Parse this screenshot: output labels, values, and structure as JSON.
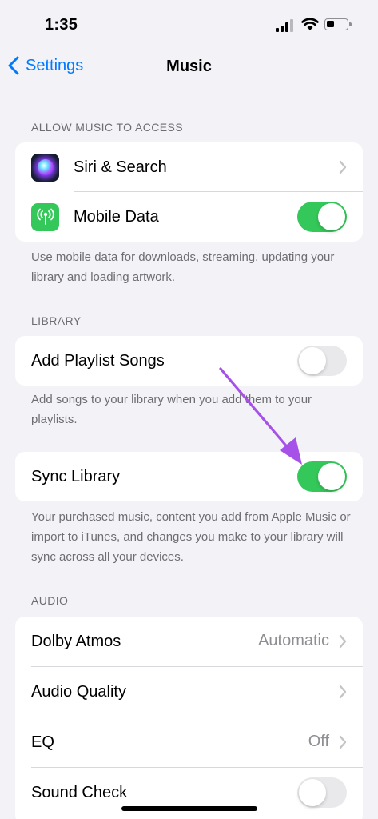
{
  "status_bar": {
    "time": "1:35"
  },
  "nav": {
    "back_label": "Settings",
    "title": "Music"
  },
  "sections": {
    "access": {
      "header": "ALLOW MUSIC TO ACCESS",
      "rows": [
        {
          "label": "Siri & Search",
          "icon": "siri-icon"
        },
        {
          "label": "Mobile Data",
          "icon": "antenna-icon",
          "toggle": true
        }
      ],
      "footer": "Use mobile data for downloads, streaming, updating your library and loading artwork."
    },
    "library": {
      "header": "LIBRARY",
      "add_playlist": {
        "label": "Add Playlist Songs",
        "toggle": false
      },
      "add_playlist_footer": "Add songs to your library when you add them to your playlists.",
      "sync": {
        "label": "Sync Library",
        "toggle": true
      },
      "sync_footer": "Your purchased music, content you add from Apple Music or import to iTunes, and changes you make to your library will sync across all your devices."
    },
    "audio": {
      "header": "AUDIO",
      "rows": [
        {
          "label": "Dolby Atmos",
          "value": "Automatic"
        },
        {
          "label": "Audio Quality"
        },
        {
          "label": "EQ",
          "value": "Off"
        },
        {
          "label": "Sound Check",
          "toggle": false
        }
      ]
    }
  },
  "colors": {
    "accent": "#007aff",
    "toggle_on": "#34c759",
    "annotation_arrow": "#a651e8"
  }
}
